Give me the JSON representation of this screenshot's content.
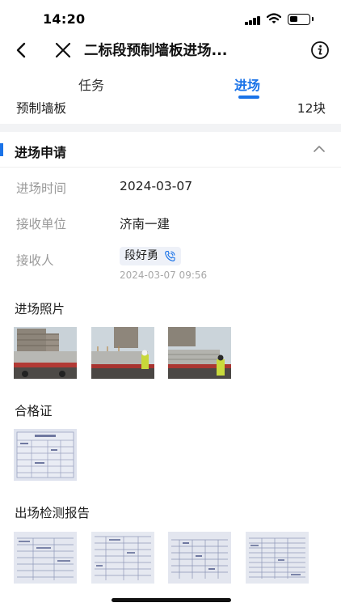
{
  "status_bar": {
    "time": "14:20"
  },
  "nav": {
    "title": "二标段预制墙板进场..."
  },
  "tabs": [
    {
      "label": "任务",
      "active": false
    },
    {
      "label": "进场",
      "active": true
    }
  ],
  "summary": {
    "name": "预制墙板",
    "quantity": "12块"
  },
  "section": {
    "title": "进场申请"
  },
  "fields": {
    "entry_time_label": "进场时间",
    "entry_time_value": "2024-03-07",
    "unit_label": "接收单位",
    "unit_value": "济南一建",
    "receiver_label": "接收人",
    "receiver_name": "段好勇",
    "receiver_time": "2024-03-07 09:56"
  },
  "groups": {
    "photos_title": "进场照片",
    "certificate_title": "合格证",
    "report_title": "出场检测报告"
  },
  "colors": {
    "accent": "#1a73e8",
    "band": "#f2f3f5",
    "chip": "#eef1f8"
  },
  "icons": [
    "back-icon",
    "close-icon",
    "info-icon",
    "chevron-up-icon",
    "phone-icon",
    "signal-icon",
    "wifi-icon",
    "battery-icon"
  ]
}
